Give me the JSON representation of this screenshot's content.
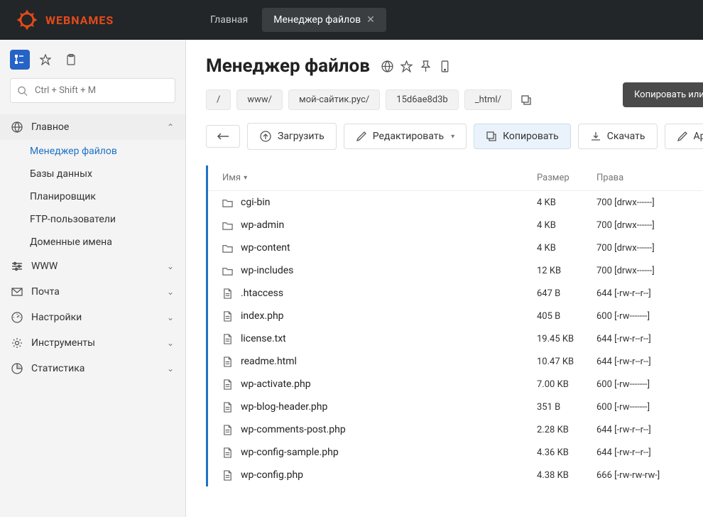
{
  "brand": "WEBNAMES",
  "top_tabs": [
    {
      "label": "Главная",
      "active": false,
      "closable": false
    },
    {
      "label": "Менеджер файлов",
      "active": true,
      "closable": true
    }
  ],
  "sidebar": {
    "search_placeholder": "Ctrl + Shift + M",
    "sections": [
      {
        "icon": "globe",
        "label": "Главное",
        "expanded": true,
        "items": [
          {
            "label": "Менеджер файлов",
            "active": true
          },
          {
            "label": "Базы данных",
            "active": false
          },
          {
            "label": "Планировщик",
            "active": false
          },
          {
            "label": "FTP-пользователи",
            "active": false
          },
          {
            "label": "Доменные имена",
            "active": false
          }
        ]
      },
      {
        "icon": "sliders",
        "label": "WWW",
        "expanded": false
      },
      {
        "icon": "mail",
        "label": "Почта",
        "expanded": false
      },
      {
        "icon": "gauge",
        "label": "Настройки",
        "expanded": false
      },
      {
        "icon": "gear",
        "label": "Инструменты",
        "expanded": false
      },
      {
        "icon": "pie",
        "label": "Статистика",
        "expanded": false
      }
    ]
  },
  "page_title": "Менеджер файлов",
  "tooltip_text": "Копировать или переместить файлы",
  "breadcrumb": [
    "/",
    "www/",
    "мой-сайтик.рус/",
    "15d6ae8d3b",
    "_html/"
  ],
  "toolbar": {
    "upload": "Загрузить",
    "edit": "Редактировать",
    "copy": "Копировать",
    "download": "Скачать",
    "archive": "Архив"
  },
  "table": {
    "head_name": "Имя",
    "head_size": "Размер",
    "head_perm": "Права",
    "rows": [
      {
        "type": "folder",
        "name": "cgi-bin",
        "size": "4 KB",
        "perm": "700 [drwx------]"
      },
      {
        "type": "folder",
        "name": "wp-admin",
        "size": "4 KB",
        "perm": "700 [drwx------]"
      },
      {
        "type": "folder",
        "name": "wp-content",
        "size": "4 KB",
        "perm": "700 [drwx------]"
      },
      {
        "type": "folder",
        "name": "wp-includes",
        "size": "12 KB",
        "perm": "700 [drwx------]"
      },
      {
        "type": "file",
        "name": ".htaccess",
        "size": "647 B",
        "perm": "644 [-rw-r--r--]"
      },
      {
        "type": "file",
        "name": "index.php",
        "size": "405 B",
        "perm": "600 [-rw-------]"
      },
      {
        "type": "file",
        "name": "license.txt",
        "size": "19.45 KB",
        "perm": "644 [-rw-r--r--]"
      },
      {
        "type": "file",
        "name": "readme.html",
        "size": "10.47 KB",
        "perm": "644 [-rw-r--r--]"
      },
      {
        "type": "file",
        "name": "wp-activate.php",
        "size": "7.00 KB",
        "perm": "600 [-rw-------]"
      },
      {
        "type": "file",
        "name": "wp-blog-header.php",
        "size": "351 B",
        "perm": "600 [-rw-------]"
      },
      {
        "type": "file",
        "name": "wp-comments-post.php",
        "size": "2.28 KB",
        "perm": "644 [-rw-r--r--]"
      },
      {
        "type": "file",
        "name": "wp-config-sample.php",
        "size": "4.36 KB",
        "perm": "644 [-rw-r--r--]"
      },
      {
        "type": "file",
        "name": "wp-config.php",
        "size": "4.38 KB",
        "perm": "666 [-rw-rw-rw-]"
      }
    ]
  }
}
